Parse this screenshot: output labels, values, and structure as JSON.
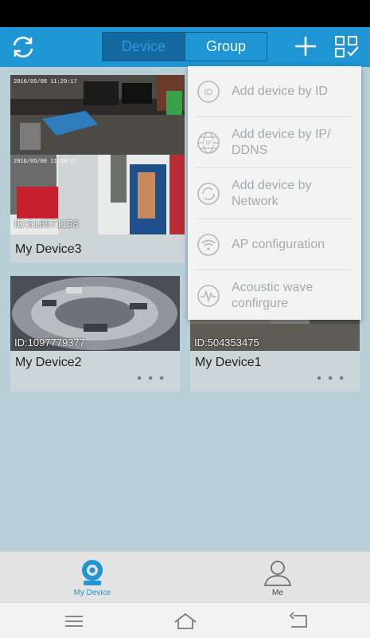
{
  "header": {
    "tabs": [
      {
        "label": "Device",
        "active": true
      },
      {
        "label": "Group",
        "active": false
      }
    ],
    "icons": [
      "refresh-icon",
      "add-icon",
      "edit-list-icon"
    ],
    "accent_color": "#1f95d3"
  },
  "devices": [
    {
      "name": "My Device3",
      "id_label": "ID:518571158",
      "timestamp": "2016/05/08 11:20:17"
    },
    {
      "name": "My Device2",
      "id_label": "ID:1097779377"
    },
    {
      "name": "My Device1",
      "id_label": "ID:504353475"
    }
  ],
  "more_label": "• • •",
  "add_menu": {
    "items": [
      {
        "label": "Add device by ID",
        "icon": "id-icon"
      },
      {
        "label": "Add device by IP/ DDNS",
        "icon": "ip-globe-icon"
      },
      {
        "label": "Add device by Network",
        "icon": "network-icon"
      },
      {
        "label": "AP configuration",
        "icon": "wifi-icon"
      },
      {
        "label": "Acoustic wave confirgure",
        "icon": "sound-wave-icon"
      }
    ]
  },
  "tabbar": {
    "items": [
      {
        "label": "My Device",
        "icon": "camera-icon",
        "active": true
      },
      {
        "label": "Me",
        "icon": "user-icon",
        "active": false
      }
    ]
  },
  "system_nav": [
    "menu-icon",
    "home-icon",
    "back-icon"
  ]
}
